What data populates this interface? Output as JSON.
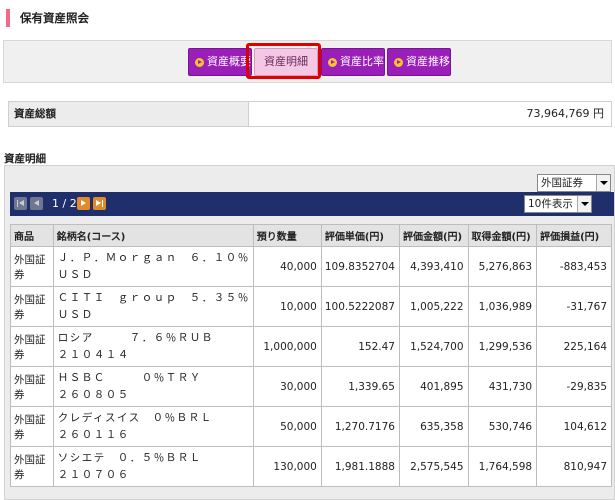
{
  "header": {
    "title": "保有資産照会"
  },
  "tabs": [
    {
      "label": "資産概要",
      "active": false
    },
    {
      "label": "資産明細",
      "active": true
    },
    {
      "label": "資産比率",
      "active": false
    },
    {
      "label": "資産推移",
      "active": false
    }
  ],
  "colors": {
    "tab_bg": "#9a1fb8",
    "tab_active_bg": "#f4c7e4",
    "highlight_frame": "#e00000",
    "pager_bar": "#1e2f6b",
    "title_mark": "#f06a8a"
  },
  "total": {
    "label": "資産総額",
    "value": "73,964,769 円"
  },
  "detail": {
    "section_title": "資産明細",
    "filter_select": {
      "value": "外国証券"
    },
    "pager": {
      "page_indicator": "1 / 2",
      "per_page": "10件表示",
      "icons": [
        "first-page-icon",
        "prev-page-icon",
        "next-page-icon",
        "last-page-icon"
      ]
    },
    "columns": [
      "商品",
      "銘柄名(コース)",
      "預り数量",
      "評価単価(円)",
      "評価金額(円)",
      "取得金額(円)",
      "評価損益(円)"
    ],
    "rows": [
      {
        "product": "外国証券",
        "name_line1": "Ｊ．Ｐ．Ｍｏｒｇａｎ　６．１０％",
        "name_line2": "ＵＳＤ",
        "quantity": "40,000",
        "unit_price": "109.8352704",
        "value": "4,393,410",
        "cost": "5,276,863",
        "pl": "-883,453"
      },
      {
        "product": "外国証券",
        "name_line1": "ＣＩＴＩ　ｇｒｏｕｐ　５．３５％",
        "name_line2": "ＵＳＤ",
        "quantity": "10,000",
        "unit_price": "100.5222087",
        "value": "1,005,222",
        "cost": "1,036,989",
        "pl": "-31,767"
      },
      {
        "product": "外国証券",
        "name_line1": "ロシア　　　７．６％ＲＵＢ",
        "name_line2": "２１０４１４",
        "quantity": "1,000,000",
        "unit_price": "152.47",
        "value": "1,524,700",
        "cost": "1,299,536",
        "pl": "225,164"
      },
      {
        "product": "外国証券",
        "name_line1": "ＨＳＢＣ　　　０％ＴＲＹ",
        "name_line2": "２６０８０５",
        "quantity": "30,000",
        "unit_price": "1,339.65",
        "value": "401,895",
        "cost": "431,730",
        "pl": "-29,835"
      },
      {
        "product": "外国証券",
        "name_line1": "クレディスイス　０％ＢＲＬ",
        "name_line2": "２６０１１６",
        "quantity": "50,000",
        "unit_price": "1,270.7176",
        "value": "635,358",
        "cost": "530,746",
        "pl": "104,612"
      },
      {
        "product": "外国証券",
        "name_line1": "ソシエテ　０．５％ＢＲＬ",
        "name_line2": "２１０７０６",
        "quantity": "130,000",
        "unit_price": "1,981.1888",
        "value": "2,575,545",
        "cost": "1,764,598",
        "pl": "810,947"
      }
    ]
  }
}
